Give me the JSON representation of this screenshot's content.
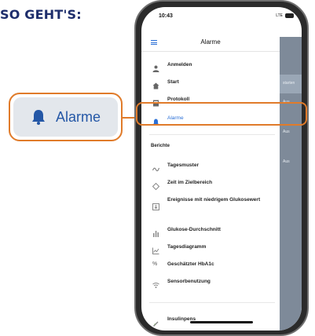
{
  "heading": "SO GEHT'S:",
  "callout": {
    "label": "Alarme"
  },
  "phone": {
    "status": {
      "time": "10:43",
      "signal": "LTE"
    },
    "header": {
      "title": "Alarme"
    },
    "background": {
      "side_label_1": "Aus",
      "side_label_2": "Aus",
      "side_label_3": "Aus",
      "blue_label": "starten"
    },
    "menu": {
      "items": [
        {
          "label": "Anmelden",
          "icon": "person-icon"
        },
        {
          "label": "Start",
          "icon": "home-icon"
        },
        {
          "label": "Protokoll",
          "icon": "logbook-icon"
        },
        {
          "label": "Alarme",
          "icon": "bell-icon",
          "active": true
        }
      ],
      "reports_heading": "Berichte",
      "reports": [
        {
          "label": "Tagesmuster",
          "icon": "pattern-icon"
        },
        {
          "label": "Zeit im Zielbereich",
          "icon": "target-icon"
        },
        {
          "label": "Ereignisse mit niedrigem Glukosewert",
          "icon": "low-events-icon"
        },
        {
          "label": "Glukose-Durchschnitt",
          "icon": "bar-chart-icon"
        },
        {
          "label": "Tagesdiagramm",
          "icon": "line-chart-icon"
        },
        {
          "label": "Geschätzter HbA1c",
          "icon": "percent-icon"
        },
        {
          "label": "Sensorbenutzung",
          "icon": "sensor-icon"
        }
      ],
      "bottom": {
        "label": "Insulinpens",
        "icon": "pen-icon"
      }
    }
  },
  "colors": {
    "accent_orange": "#e07b2a",
    "brand_blue": "#2a6fd6",
    "heading_navy": "#1d2d6b"
  }
}
